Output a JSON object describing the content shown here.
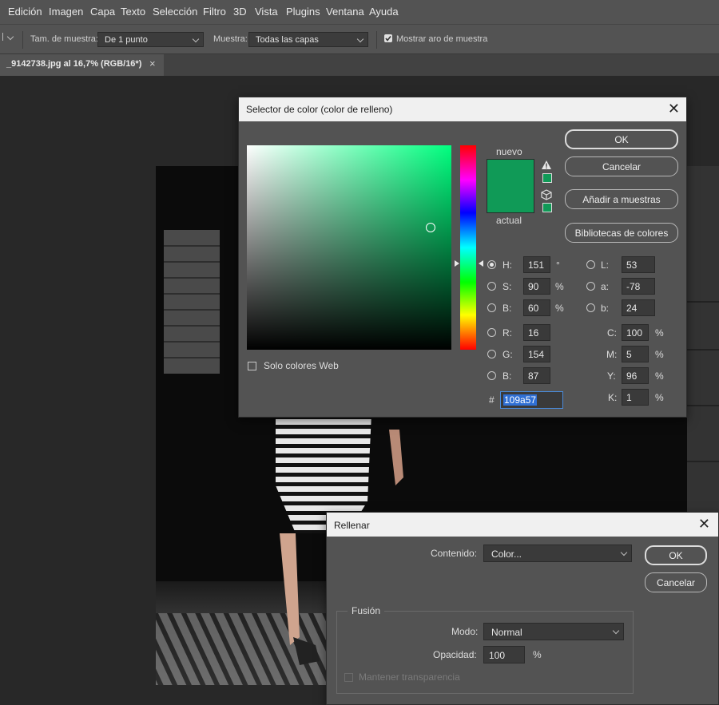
{
  "menu": [
    "Edición",
    "Imagen",
    "Capa",
    "Texto",
    "Selección",
    "Filtro",
    "3D",
    "Vista",
    "Plugins",
    "Ventana",
    "Ayuda"
  ],
  "options": {
    "sample_size_label": "Tam. de muestra:",
    "sample_size_value": "De 1 punto",
    "sample_label": "Muestra:",
    "sample_value": "Todas las capas",
    "show_ring_label": "Mostrar aro de muestra",
    "show_ring_checked": true
  },
  "document_tab": {
    "title": "_9142738.jpg al 16,7% (RGB/16*)",
    "close": "×"
  },
  "color_picker": {
    "title": "Selector de color (color de relleno)",
    "close": "✕",
    "hue_color": "#00ff7f",
    "new_label": "nuevo",
    "current_label": "actual",
    "new_color": "#109a57",
    "current_color": "#109a57",
    "buttons": {
      "ok": "OK",
      "cancel": "Cancelar",
      "add_swatches": "Añadir a muestras",
      "libraries": "Bibliotecas de colores"
    },
    "web_only_label": "Solo colores Web",
    "hsb": {
      "h_label": "H:",
      "h": "151",
      "h_unit": "°",
      "s_label": "S:",
      "s": "90",
      "s_unit": "%",
      "b_label": "B:",
      "b": "60",
      "b_unit": "%"
    },
    "rgb": {
      "r_label": "R:",
      "r": "16",
      "g_label": "G:",
      "g": "154",
      "b_label": "B:",
      "b": "87"
    },
    "lab": {
      "l_label": "L:",
      "l": "53",
      "a_label": "a:",
      "a": "-78",
      "b_label": "b:",
      "b": "24"
    },
    "cmyk": {
      "c_label": "C:",
      "c": "100",
      "m_label": "M:",
      "m": "5",
      "y_label": "Y:",
      "y": "96",
      "k_label": "K:",
      "k": "1",
      "unit": "%"
    },
    "hex_label": "#",
    "hex": "109a57",
    "selected_mode": "H"
  },
  "fill_dialog": {
    "title": "Rellenar",
    "close": "✕",
    "content_label": "Contenido:",
    "content_value": "Color...",
    "ok": "OK",
    "cancel": "Cancelar",
    "blending_group": "Fusión",
    "mode_label": "Modo:",
    "mode_value": "Normal",
    "opacity_label": "Opacidad:",
    "opacity_value": "100",
    "opacity_unit": "%",
    "preserve_label": "Mantener transparencia"
  }
}
